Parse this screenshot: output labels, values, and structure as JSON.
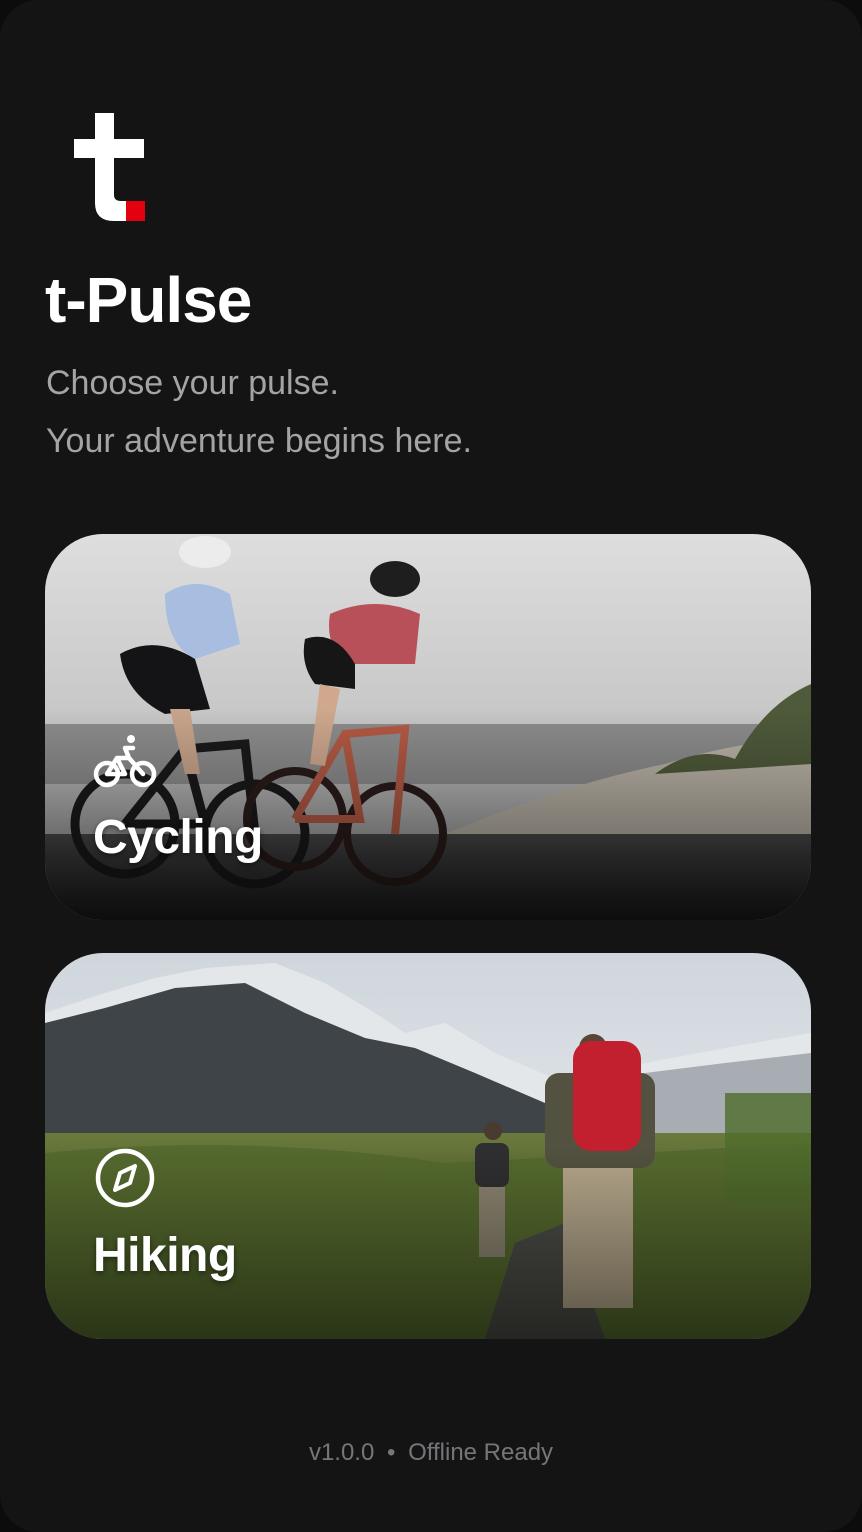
{
  "app": {
    "title": "t-Pulse",
    "tagline_line1": "Choose your pulse.",
    "tagline_line2": "Your adventure begins here."
  },
  "brand": {
    "logo_icon": "t-logo-icon",
    "accent_color": "#e3000f",
    "background_color": "#141415"
  },
  "activities": [
    {
      "label": "Cycling",
      "icon": "bicycle-icon"
    },
    {
      "label": "Hiking",
      "icon": "compass-icon"
    }
  ],
  "footer": {
    "version": "v1.0.0",
    "separator": "•",
    "status": "Offline Ready"
  }
}
